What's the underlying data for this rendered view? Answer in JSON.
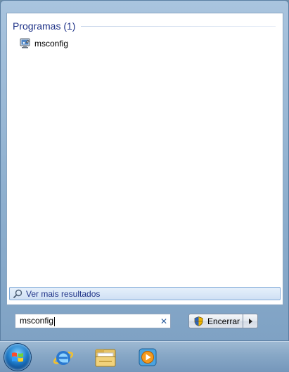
{
  "results": {
    "section_title": "Programas (1)",
    "programs": [
      {
        "label": "msconfig",
        "icon": "msconfig-icon"
      }
    ],
    "see_more_label": "Ver mais resultados"
  },
  "search": {
    "value": "msconfig",
    "clear_glyph": "✕"
  },
  "shutdown": {
    "label": "Encerrar"
  },
  "taskbar": {
    "icons": [
      "start-orb",
      "internet-explorer-icon",
      "windows-explorer-icon",
      "windows-media-player-icon"
    ]
  },
  "colors": {
    "section_title": "#1e3287",
    "frame": "#8fb0cf",
    "panel": "#ffffff"
  }
}
